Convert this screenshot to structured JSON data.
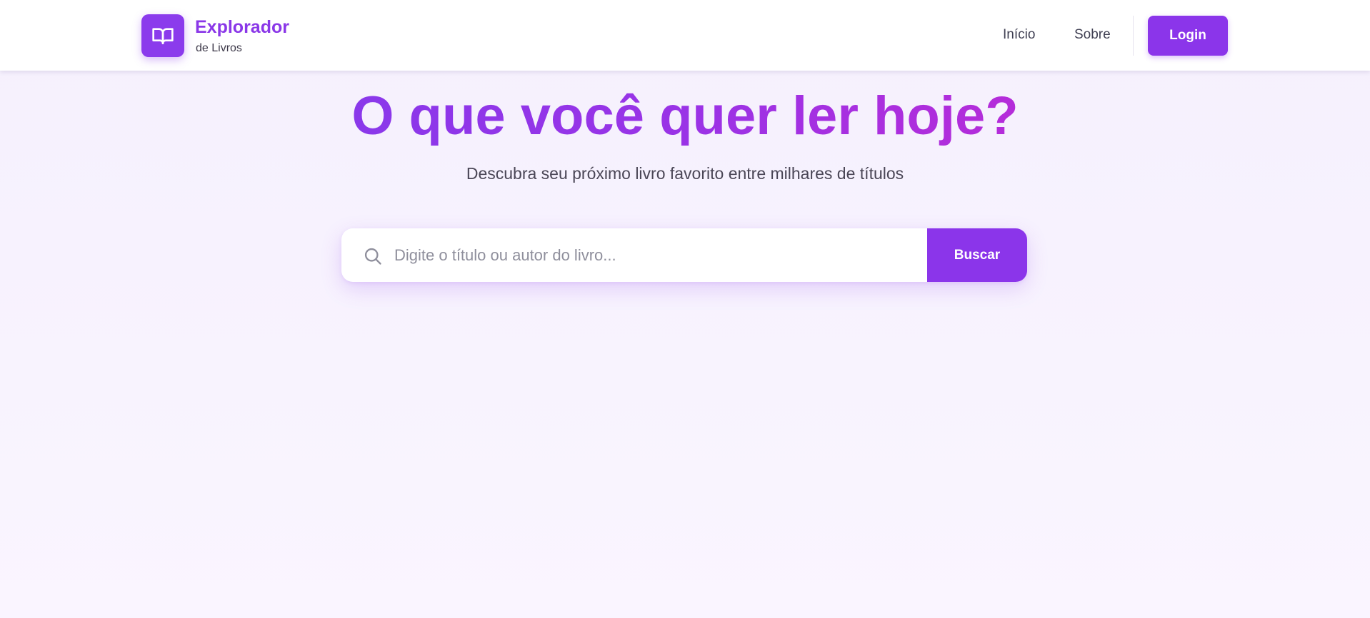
{
  "header": {
    "logo_title": "Explorador",
    "logo_subtitle": "de Livros",
    "logo_icon": "open-book-icon",
    "nav": {
      "home_label": "Início",
      "about_label": "Sobre"
    },
    "login_label": "Login"
  },
  "hero": {
    "title": "O que você quer ler hoje?",
    "subtitle": "Descubra seu próximo livro favorito entre milhares de títulos"
  },
  "search": {
    "icon": "search-icon",
    "value": "",
    "placeholder": "Digite o título ou autor do livro...",
    "button_label": "Buscar"
  },
  "colors": {
    "accent": "#8b35ea",
    "title_gradient_start": "#8a38ea",
    "title_gradient_end": "#b52cd9",
    "background": "#f7f2fe"
  }
}
